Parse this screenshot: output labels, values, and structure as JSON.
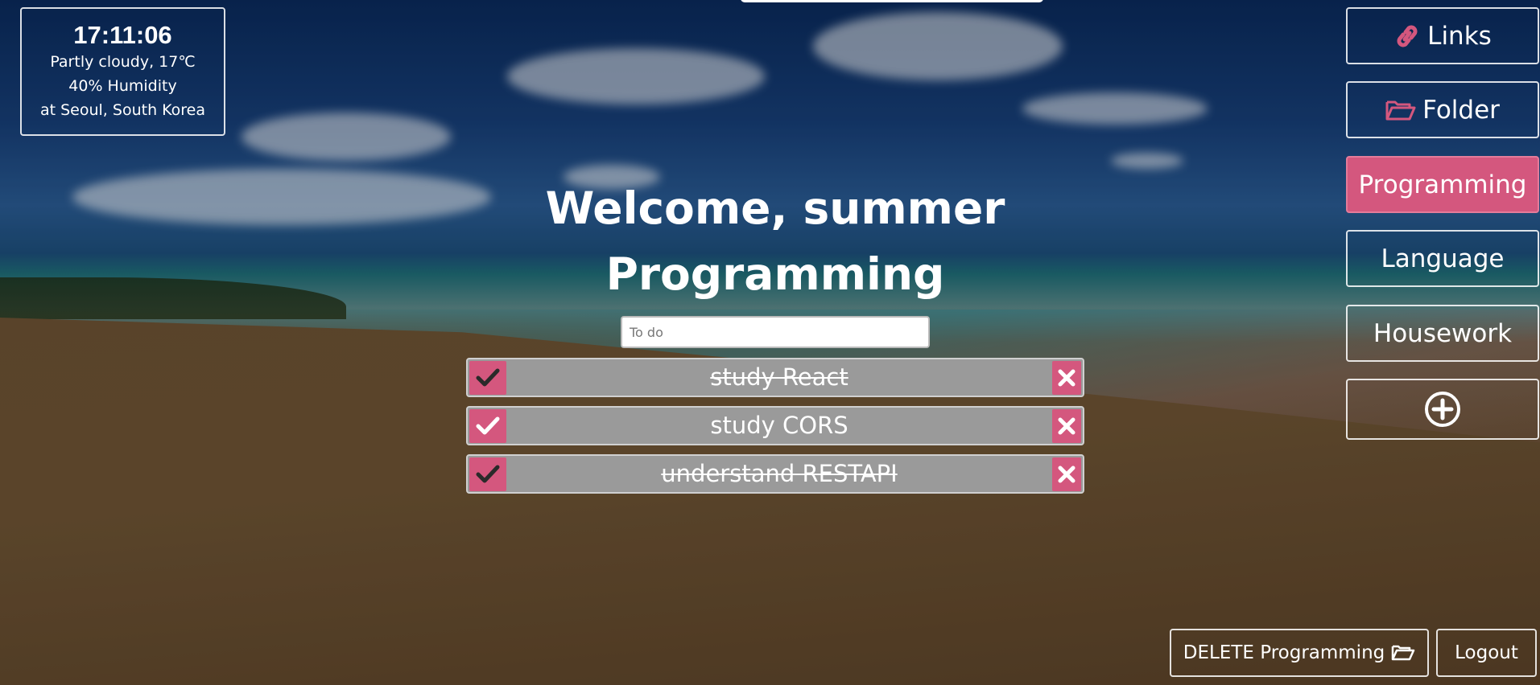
{
  "weather": {
    "time": "17:11:06",
    "condition": "Partly cloudy, 17℃",
    "humidity": "40% Humidity",
    "location": "at Seoul, South Korea"
  },
  "welcome": {
    "greeting": "Welcome, summer",
    "category": "Programming"
  },
  "todo_input": {
    "placeholder": "To do",
    "value": ""
  },
  "todos": [
    {
      "text": "study React",
      "done": true
    },
    {
      "text": "study CORS",
      "done": false
    },
    {
      "text": "understand RESTAPI",
      "done": true
    }
  ],
  "sidebar": {
    "links_label": "Links",
    "folder_label": "Folder",
    "categories": [
      "Programming",
      "Language",
      "Housework"
    ],
    "active_category": "Programming"
  },
  "footer": {
    "delete_label": "DELETE Programming",
    "logout_label": "Logout"
  },
  "icons": {
    "links": "link-icon",
    "folder": "folder-open-icon",
    "add": "plus-circle-icon",
    "check": "check-icon",
    "delete": "x-icon"
  },
  "colors": {
    "accent": "#d4577e",
    "todo_bg": "#9a9a9a"
  }
}
